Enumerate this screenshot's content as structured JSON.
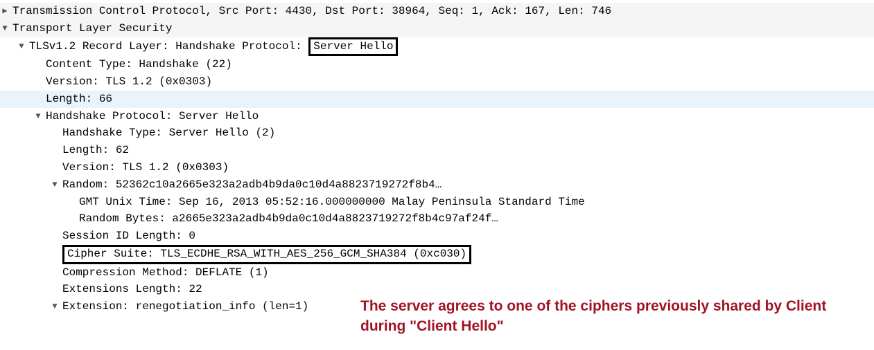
{
  "rows": {
    "tcp": "Transmission Control Protocol, Src Port: 4430, Dst Port: 38964, Seq: 1, Ack: 167, Len: 746",
    "tls": "Transport Layer Security",
    "record_prefix": "TLSv1.2 Record Layer: Handshake Protocol: ",
    "record_box": "Server Hello",
    "content_type": "Content Type: Handshake (22)",
    "version_outer": "Version: TLS 1.2 (0x0303)",
    "length_outer": "Length: 66",
    "hs_proto": "Handshake Protocol: Server Hello",
    "hs_type": "Handshake Type: Server Hello (2)",
    "hs_len": "Length: 62",
    "hs_version": "Version: TLS 1.2 (0x0303)",
    "random": "Random: 52362c10a2665e323a2adb4b9da0c10d4a8823719272f8b4…",
    "gmt": "GMT Unix Time: Sep 16, 2013 05:52:16.000000000 Malay Peninsula Standard Time",
    "rand_bytes": "Random Bytes: a2665e323a2adb4b9da0c10d4a8823719272f8b4c97af24f…",
    "sid_len": "Session ID Length: 0",
    "cipher": "Cipher Suite: TLS_ECDHE_RSA_WITH_AES_256_GCM_SHA384 (0xc030)",
    "compression": "Compression Method: DEFLATE (1)",
    "ext_len": "Extensions Length: 22",
    "ext_reneg": "Extension: renegotiation_info (len=1)"
  },
  "annotation": "The server agrees to one of the ciphers previously shared by Client during \"Client Hello\""
}
